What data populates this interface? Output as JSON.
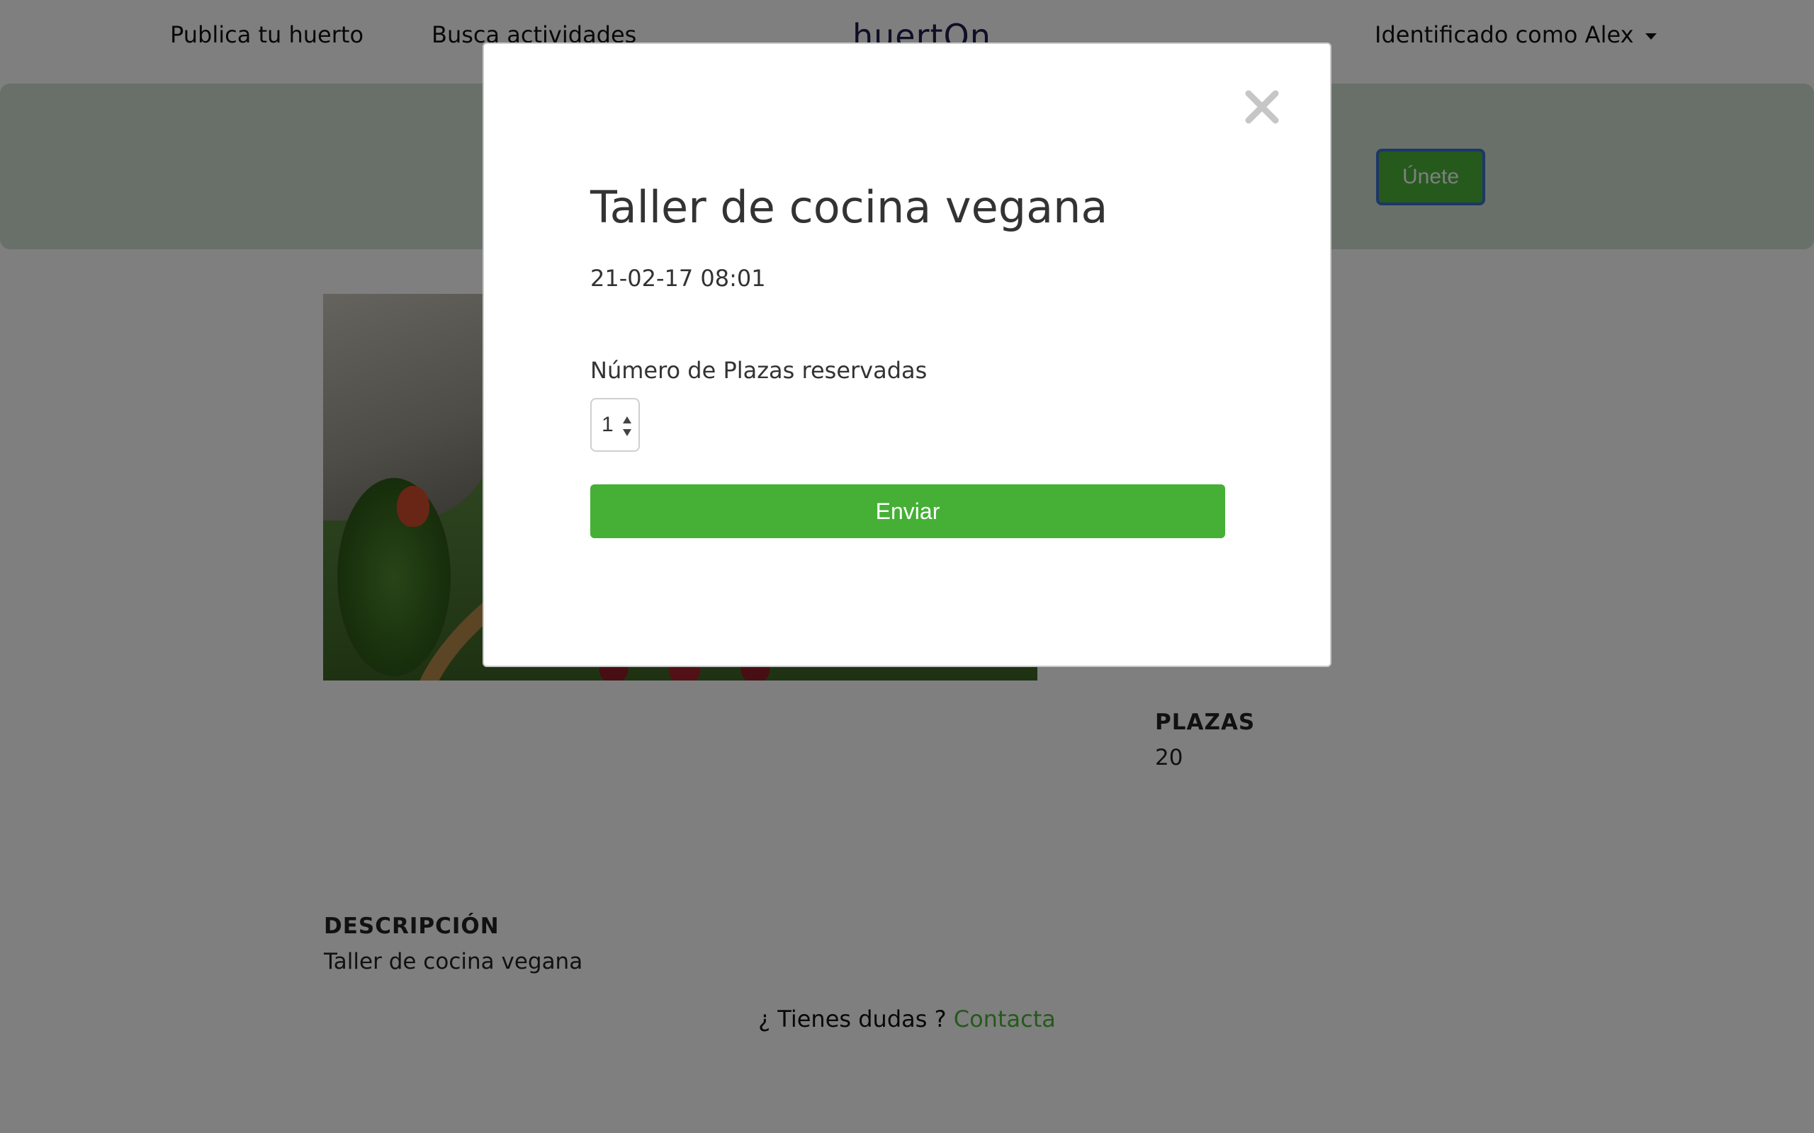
{
  "navbar": {
    "publish_link": "Publica tu huerto",
    "search_link": "Busca actividades",
    "logo": "huertOn",
    "user_menu": "Identificado como Alex"
  },
  "banner": {
    "join_button": "Únete"
  },
  "details": {
    "plazas_label": "PLAZAS",
    "plazas_value": "20",
    "description_label": "DESCRIPCIÓN",
    "description_value": "Taller de cocina vegana"
  },
  "footer": {
    "question": "¿ Tienes dudas ?",
    "contact_link": "Contacta"
  },
  "modal": {
    "title": "Taller de cocina vegana",
    "date": "21-02-17 08:01",
    "field_label": "Número de Plazas reservadas",
    "stepper_value": "1",
    "submit_button": "Enviar",
    "close_icon": "close-icon"
  },
  "colors": {
    "accent_green": "#45b035",
    "link_green": "#4ab539",
    "overlay": "rgba(0,0,0,0.5)"
  }
}
